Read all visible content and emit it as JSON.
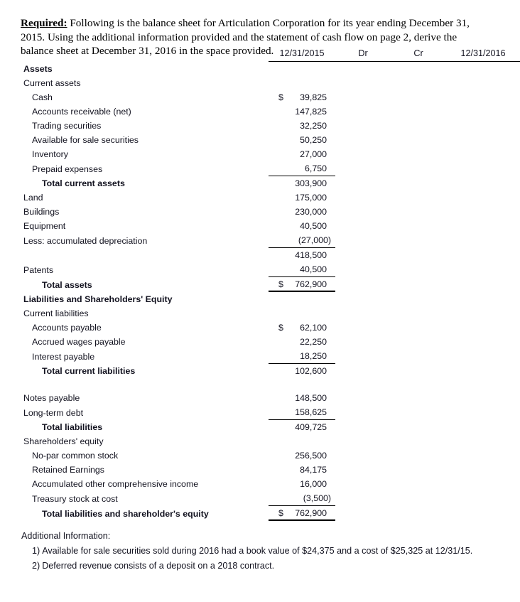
{
  "intro": {
    "required_label": "Required:",
    "text": " Following is the balance sheet for Articulation Corporation for its year ending December 31, 2015.  Using the additional information provided and the statement of cash flow on page 2, derive the balance sheet at December 31, 2016 in the space provided."
  },
  "columns": {
    "label": "",
    "current": "12/31/2015",
    "dr": "Dr",
    "cr": "Cr",
    "next": "12/31/2016"
  },
  "rows": [
    {
      "label": "Assets",
      "indent": 0,
      "bold": true,
      "value": "",
      "sign": ""
    },
    {
      "label": "Current assets",
      "indent": 0,
      "bold": false,
      "value": "",
      "sign": ""
    },
    {
      "label": "Cash",
      "indent": 1,
      "bold": false,
      "value": "39,825",
      "sign": "$"
    },
    {
      "label": "Accounts receivable (net)",
      "indent": 1,
      "bold": false,
      "value": "147,825",
      "sign": ""
    },
    {
      "label": "Trading securities",
      "indent": 1,
      "bold": false,
      "value": "32,250",
      "sign": ""
    },
    {
      "label": "Available for sale securities",
      "indent": 1,
      "bold": false,
      "value": "50,250",
      "sign": ""
    },
    {
      "label": "Inventory",
      "indent": 1,
      "bold": false,
      "value": "27,000",
      "sign": ""
    },
    {
      "label": "Prepaid  expenses",
      "indent": 1,
      "bold": false,
      "value": "6,750",
      "sign": ""
    },
    {
      "label": "Total current assets",
      "indent": 2,
      "bold": true,
      "value": "303,900",
      "sign": ""
    },
    {
      "label": "Land",
      "indent": 0,
      "bold": false,
      "value": "175,000",
      "sign": ""
    },
    {
      "label": "Buildings",
      "indent": 0,
      "bold": false,
      "value": "230,000",
      "sign": ""
    },
    {
      "label": "Equipment",
      "indent": 0,
      "bold": false,
      "value": "40,500",
      "sign": ""
    },
    {
      "label": "Less: accumulated depreciation",
      "indent": 0,
      "bold": false,
      "value": "(27,000)",
      "sign": ""
    },
    {
      "label": "",
      "indent": 0,
      "bold": false,
      "value": "418,500",
      "sign": ""
    },
    {
      "label": "Patents",
      "indent": 0,
      "bold": false,
      "value": "40,500",
      "sign": ""
    },
    {
      "label": "Total assets",
      "indent": 2,
      "bold": true,
      "value": "762,900",
      "sign": "$"
    },
    {
      "label": "Liabilities and Shareholders' Equity",
      "indent": 0,
      "bold": true,
      "value": "",
      "sign": ""
    },
    {
      "label": "Current liabilities",
      "indent": 0,
      "bold": false,
      "value": "",
      "sign": ""
    },
    {
      "label": "Accounts payable",
      "indent": 1,
      "bold": false,
      "value": "62,100",
      "sign": "$"
    },
    {
      "label": "Accrued wages payable",
      "indent": 1,
      "bold": false,
      "value": "22,250",
      "sign": ""
    },
    {
      "label": "Interest payable",
      "indent": 1,
      "bold": false,
      "value": "18,250",
      "sign": ""
    },
    {
      "label": "Total current liabilities",
      "indent": 2,
      "bold": true,
      "value": "102,600",
      "sign": ""
    },
    {
      "label": "",
      "indent": 0,
      "bold": false,
      "value": "",
      "sign": ""
    },
    {
      "label": "Notes payable",
      "indent": 0,
      "bold": false,
      "value": "148,500",
      "sign": ""
    },
    {
      "label": "Long-term debt",
      "indent": 0,
      "bold": false,
      "value": "158,625",
      "sign": ""
    },
    {
      "label": "Total liabilities",
      "indent": 2,
      "bold": true,
      "value": "409,725",
      "sign": ""
    },
    {
      "label": "Shareholders' equity",
      "indent": 0,
      "bold": false,
      "value": "",
      "sign": ""
    },
    {
      "label": "No-par common stock",
      "indent": 1,
      "bold": false,
      "value": "256,500",
      "sign": ""
    },
    {
      "label": "Retained Earnings",
      "indent": 1,
      "bold": false,
      "value": "84,175",
      "sign": ""
    },
    {
      "label": "Accumulated other comprehensive income",
      "indent": 1,
      "bold": false,
      "value": "16,000",
      "sign": ""
    },
    {
      "label": "Treasury stock at cost",
      "indent": 1,
      "bold": false,
      "value": "(3,500)",
      "sign": ""
    },
    {
      "label": "Total liabilities and shareholder's equity",
      "indent": 2,
      "bold": true,
      "value": "762,900",
      "sign": "$"
    }
  ],
  "additional": {
    "title": "Additional Information:",
    "items": [
      {
        "num": "1)",
        "text": "Available for sale securities sold during 2016 had a book value of $24,375 and a cost of $25,325 at 12/31/15."
      },
      {
        "num": "2)",
        "text": "Deferred revenue consists of a deposit on a 2018 contract."
      }
    ]
  }
}
